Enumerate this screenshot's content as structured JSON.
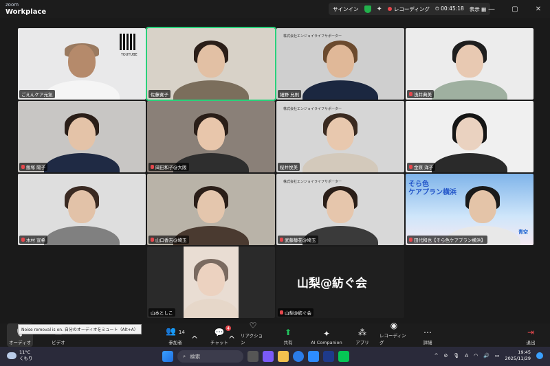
{
  "app": {
    "brand_small": "zoom",
    "brand_main": "Workplace"
  },
  "statusbar": {
    "signin": "サインイン",
    "recording": "レコーディング",
    "timer": "00:45:18",
    "view": "表示"
  },
  "tiles": [
    {
      "name": "ごえんケア元気",
      "muted": false,
      "shirt": "#f1f1f1"
    },
    {
      "name": "佐藤寛子",
      "muted": false,
      "shirt": "#7b6e5c"
    },
    {
      "name": "細野 允則",
      "muted": false,
      "shirt": "#1b2740"
    },
    {
      "name": "浅井典美",
      "muted": true,
      "shirt": "#9fb0a0"
    },
    {
      "name": "飯塚 陽子",
      "muted": true,
      "shirt": "#1f2a44"
    },
    {
      "name": "岡田和子@大阪",
      "muted": true,
      "shirt": "#2e2e2e"
    },
    {
      "name": "桜井悦美",
      "muted": false,
      "shirt": "#d3c9bb"
    },
    {
      "name": "金原 洋子",
      "muted": true,
      "shirt": "#2a2a2a"
    },
    {
      "name": "木村 宣希",
      "muted": true,
      "shirt": "#808080"
    },
    {
      "name": "山口香吉@埼玉",
      "muted": true,
      "shirt": "#4a3a30"
    },
    {
      "name": "武藤静花@埼玉",
      "muted": true,
      "shirt": "#3a3a3a"
    },
    {
      "name": "田代和也【そら色ケアプラン横浜】",
      "muted": true,
      "shirt": "#e8e8e8"
    },
    {
      "name": "山本としこ",
      "muted": false,
      "shirt": "#e6d7c9"
    },
    {
      "name": "山梨@紡ぐ会",
      "muted": true,
      "shirt": ""
    }
  ],
  "tile_texts": {
    "company": "株式会社エンジョイライフサポーター",
    "sora": "そら色",
    "careplan": "ケアプラン横浜",
    "aozora": "青空",
    "youtube": "YOUTUBE"
  },
  "center_text": "山梨@紡ぐ会",
  "tooltip": "Noise removal is on. 自分のオーディオをミュート（Alt+A）",
  "toolbar": {
    "audio": "オーディオ",
    "video": "ビデオ",
    "participants": "参加者",
    "participants_count": "14",
    "chat": "チャット",
    "chat_badge": "4",
    "reactions": "リアクション",
    "share": "共有",
    "ai": "AI Companion",
    "apps": "アプリ",
    "record": "レコーディング",
    "more": "詳細",
    "leave": "退出"
  },
  "taskbar": {
    "temp": "11°C",
    "weather": "くもり",
    "search": "検索",
    "time": "19:45",
    "date": "2025/11/29"
  }
}
